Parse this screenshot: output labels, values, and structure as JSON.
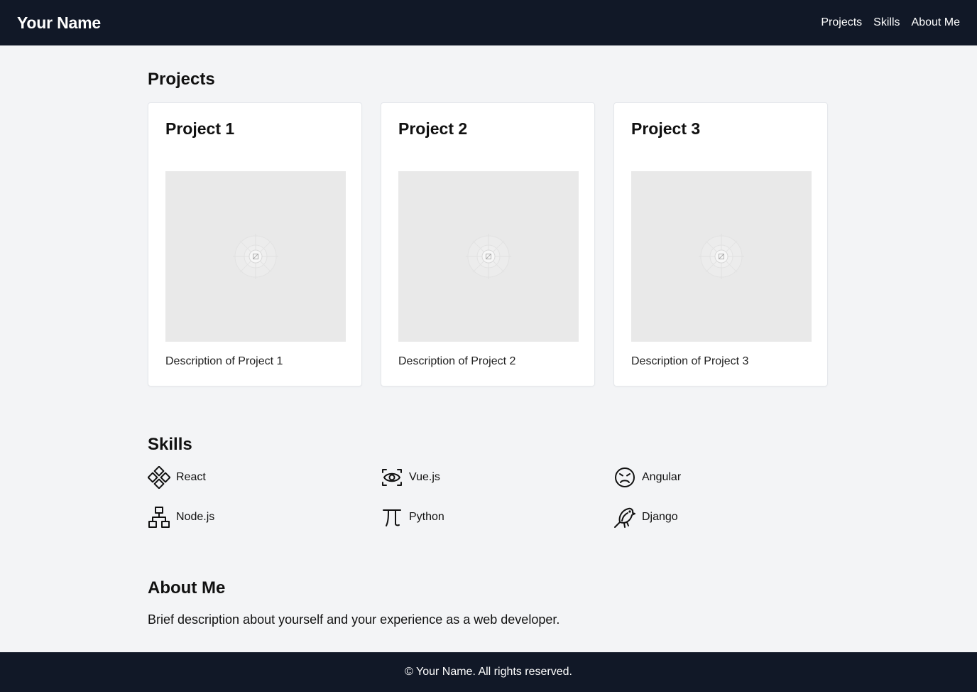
{
  "header": {
    "brand": "Your Name",
    "nav": [
      "Projects",
      "Skills",
      "About Me"
    ]
  },
  "projects": {
    "title": "Projects",
    "items": [
      {
        "title": "Project 1",
        "description": "Description of Project 1",
        "image_icon": "image-placeholder-icon"
      },
      {
        "title": "Project 2",
        "description": "Description of Project 2",
        "image_icon": "image-placeholder-icon"
      },
      {
        "title": "Project 3",
        "description": "Description of Project 3",
        "image_icon": "image-placeholder-icon"
      }
    ]
  },
  "skills": {
    "title": "Skills",
    "items": [
      {
        "label": "React",
        "icon": "diamonds-icon"
      },
      {
        "label": "Vue.js",
        "icon": "eye-frame-icon"
      },
      {
        "label": "Angular",
        "icon": "angry-face-icon"
      },
      {
        "label": "Node.js",
        "icon": "hierarchy-icon"
      },
      {
        "label": "Python",
        "icon": "pi-icon"
      },
      {
        "label": "Django",
        "icon": "bird-icon"
      }
    ]
  },
  "about": {
    "title": "About Me",
    "text": "Brief description about yourself and your experience as a web developer."
  },
  "footer": {
    "text": "© Your Name. All rights reserved."
  },
  "colors": {
    "dark": "#111827",
    "background": "#f3f4f6",
    "card": "#ffffff",
    "placeholder": "#e9e9e9"
  }
}
